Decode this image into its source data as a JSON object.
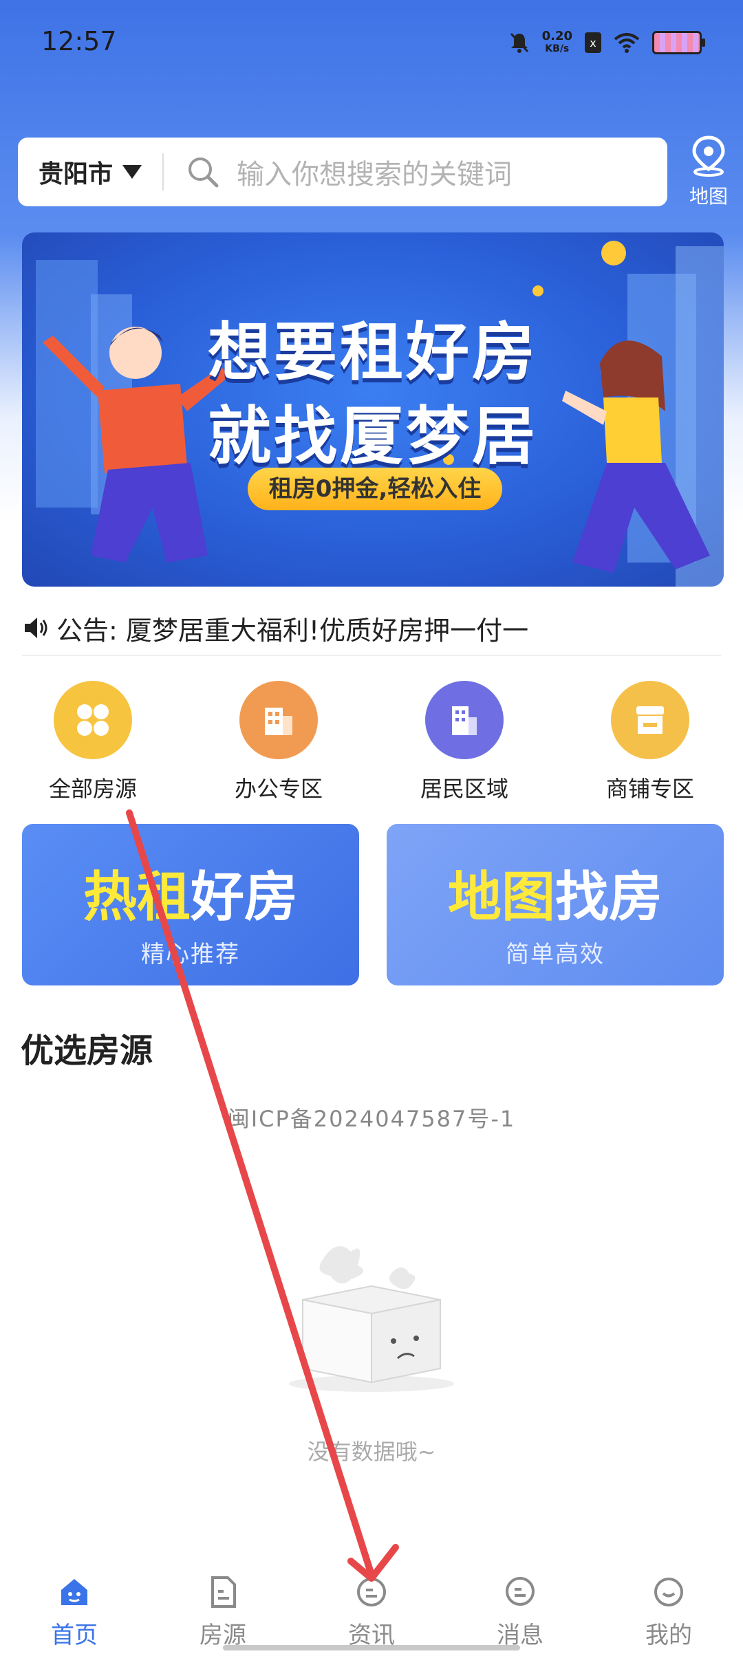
{
  "status_bar": {
    "time": "12:57",
    "net_speed_value": "0.20",
    "net_speed_unit": "KB/s",
    "sim_label": "x"
  },
  "search": {
    "city": "贵阳市",
    "placeholder": "输入你想搜索的关键词",
    "map_label": "地图"
  },
  "banner": {
    "line1": "想要租好房",
    "line2": "就找厦梦居",
    "tagline": "租房0押金,轻松入住"
  },
  "notice": {
    "text": "公告: 厦梦居重大福利!优质好房押一付一"
  },
  "categories": [
    {
      "label": "全部房源",
      "color": "#f7c440",
      "icon": "grid-icon"
    },
    {
      "label": "办公专区",
      "color": "#f19b52",
      "icon": "office-building-icon"
    },
    {
      "label": "居民区域",
      "color": "#6f6fe3",
      "icon": "residential-building-icon"
    },
    {
      "label": "商铺专区",
      "color": "#f5c04a",
      "icon": "shop-icon"
    }
  ],
  "promos": [
    {
      "title_highlight": "热租",
      "title_rest": "好房",
      "subtitle": "精心推荐"
    },
    {
      "title_highlight": "地图",
      "title_rest": "找房",
      "subtitle": "简单高效"
    }
  ],
  "section": {
    "title": "优选房源"
  },
  "icp": "闽ICP备2024047587号-1",
  "empty_state": {
    "text": "没有数据哦~"
  },
  "tabs": [
    {
      "label": "首页",
      "icon": "home-icon",
      "active": true
    },
    {
      "label": "房源",
      "icon": "listing-icon",
      "active": false
    },
    {
      "label": "资讯",
      "icon": "news-icon",
      "active": false
    },
    {
      "label": "消息",
      "icon": "message-icon",
      "active": false
    },
    {
      "label": "我的",
      "icon": "profile-icon",
      "active": false
    }
  ],
  "colors": {
    "primary": "#3a74e8",
    "tab_inactive": "#8a8a8a",
    "annotation_arrow": "#e8474a",
    "highlight_yellow": "#ffe93b"
  }
}
